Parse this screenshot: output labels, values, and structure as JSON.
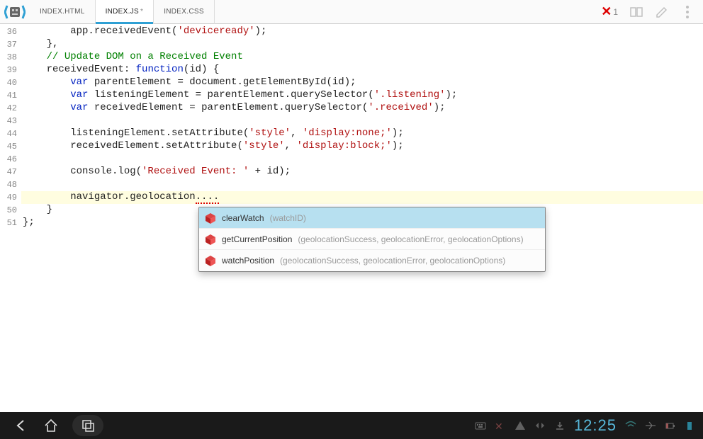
{
  "tabs": [
    {
      "label": "INDEX.HTML",
      "modified": false,
      "active": false
    },
    {
      "label": "INDEX.JS",
      "modified": true,
      "active": true
    },
    {
      "label": "INDEX.CSS",
      "modified": false,
      "active": false
    }
  ],
  "error_count": "1",
  "lines": {
    "start": 36,
    "end": 51,
    "tokens": [
      [
        {
          "indent": 8
        },
        {
          "t": "app",
          "c": ""
        },
        {
          "t": ".",
          "c": ""
        },
        {
          "t": "receivedEvent",
          "c": ""
        },
        {
          "t": "(",
          "c": ""
        },
        {
          "t": "'deviceready'",
          "c": "str"
        },
        {
          "t": ");",
          "c": ""
        }
      ],
      [
        {
          "indent": 4
        },
        {
          "t": "},",
          "c": ""
        }
      ],
      [
        {
          "indent": 4
        },
        {
          "t": "// Update DOM on a Received Event",
          "c": "com"
        }
      ],
      [
        {
          "indent": 4
        },
        {
          "t": "receivedEvent",
          "c": ""
        },
        {
          "t": ": ",
          "c": ""
        },
        {
          "t": "function",
          "c": "kw"
        },
        {
          "t": "(",
          "c": ""
        },
        {
          "t": "id",
          "c": ""
        },
        {
          "t": ") {",
          "c": ""
        }
      ],
      [
        {
          "indent": 8
        },
        {
          "t": "var",
          "c": "kw"
        },
        {
          "t": " parentElement = document.getElementById(",
          "c": ""
        },
        {
          "t": "id",
          "c": ""
        },
        {
          "t": ");",
          "c": ""
        }
      ],
      [
        {
          "indent": 8
        },
        {
          "t": "var",
          "c": "kw"
        },
        {
          "t": " listeningElement = parentElement.querySelector(",
          "c": ""
        },
        {
          "t": "'.listening'",
          "c": "str"
        },
        {
          "t": ");",
          "c": ""
        }
      ],
      [
        {
          "indent": 8
        },
        {
          "t": "var",
          "c": "kw"
        },
        {
          "t": " receivedElement = parentElement.querySelector(",
          "c": ""
        },
        {
          "t": "'.received'",
          "c": "str"
        },
        {
          "t": ");",
          "c": ""
        }
      ],
      [
        {
          "indent": 0
        }
      ],
      [
        {
          "indent": 8
        },
        {
          "t": "listeningElement.setAttribute(",
          "c": ""
        },
        {
          "t": "'style'",
          "c": "str"
        },
        {
          "t": ", ",
          "c": ""
        },
        {
          "t": "'display:none;'",
          "c": "str"
        },
        {
          "t": ");",
          "c": ""
        }
      ],
      [
        {
          "indent": 8
        },
        {
          "t": "receivedElement.setAttribute(",
          "c": ""
        },
        {
          "t": "'style'",
          "c": "str"
        },
        {
          "t": ", ",
          "c": ""
        },
        {
          "t": "'display:block;'",
          "c": "str"
        },
        {
          "t": ");",
          "c": ""
        }
      ],
      [
        {
          "indent": 0
        }
      ],
      [
        {
          "indent": 8
        },
        {
          "t": "console.log(",
          "c": ""
        },
        {
          "t": "'Received Event: '",
          "c": "str"
        },
        {
          "t": " + id);",
          "c": ""
        }
      ],
      [
        {
          "indent": 0
        }
      ],
      [
        {
          "indent": 8,
          "hl": true
        },
        {
          "t": "navigator.geolocation",
          "c": ""
        },
        {
          "t": ".",
          "c": "err"
        }
      ],
      [
        {
          "indent": 4
        },
        {
          "t": "}",
          "c": ""
        }
      ],
      [
        {
          "indent": 0
        },
        {
          "t": "};",
          "c": ""
        }
      ]
    ]
  },
  "autocomplete": [
    {
      "name": "clearWatch",
      "params": "(watchID)",
      "selected": true
    },
    {
      "name": "getCurrentPosition",
      "params": "(geolocationSuccess, geolocationError, geolocationOptions)",
      "selected": false
    },
    {
      "name": "watchPosition",
      "params": "(geolocationSuccess, geolocationError, geolocationOptions)",
      "selected": false
    }
  ],
  "navbar": {
    "clock": "12:25"
  }
}
